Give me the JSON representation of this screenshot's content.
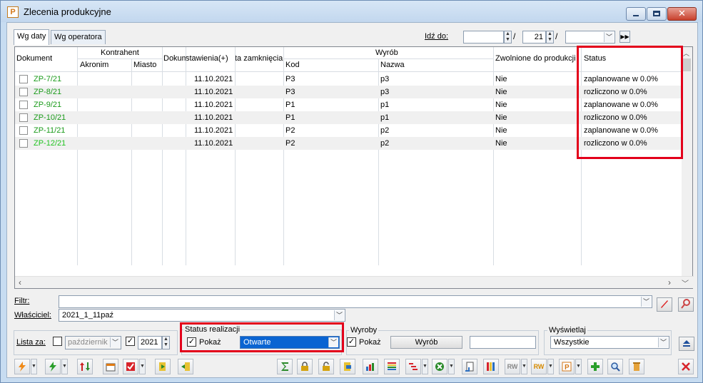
{
  "window": {
    "title": "Zlecenia produkcyjne",
    "app_icon_letter": "P"
  },
  "tabs": [
    "Wg daty",
    "Wg operatora"
  ],
  "goto": {
    "label": "Idź do:",
    "day": "",
    "month": "21",
    "year": ""
  },
  "grid": {
    "headers": {
      "dokument": "Dokument",
      "kontrahent": "Kontrahent",
      "akronim": "Akronim",
      "miasto": "Miasto",
      "dokumenty": "Dokum",
      "data_wystawienia": "stawienia(+)",
      "data_zamkniecia": "ta zamknięcia",
      "wyrob": "Wyrób",
      "kod": "Kod",
      "nazwa": "Nazwa",
      "zwolnione": "Zwolnione do produkcji",
      "status": "Status"
    },
    "rows": [
      {
        "doc": "ZP-7/21",
        "date": "11.10.2021",
        "kod": "P3",
        "nazwa": "p3",
        "zwolnione": "Nie",
        "status": "zaplanowane w 0.0%"
      },
      {
        "doc": "ZP-8/21",
        "date": "11.10.2021",
        "kod": "P3",
        "nazwa": "p3",
        "zwolnione": "Nie",
        "status": "rozliczono w 0.0%"
      },
      {
        "doc": "ZP-9/21",
        "date": "11.10.2021",
        "kod": "P1",
        "nazwa": "p1",
        "zwolnione": "Nie",
        "status": "zaplanowane w 0.0%"
      },
      {
        "doc": "ZP-10/21",
        "date": "11.10.2021",
        "kod": "P1",
        "nazwa": "p1",
        "zwolnione": "Nie",
        "status": "rozliczono w 0.0%"
      },
      {
        "doc": "ZP-11/21",
        "date": "11.10.2021",
        "kod": "P2",
        "nazwa": "p2",
        "zwolnione": "Nie",
        "status": "zaplanowane w 0.0%"
      },
      {
        "doc": "ZP-12/21",
        "date": "11.10.2021",
        "kod": "P2",
        "nazwa": "p2",
        "zwolnione": "Nie",
        "status": "rozliczono w 0.0%"
      }
    ]
  },
  "filters": {
    "filtr_label": "Filtr:",
    "filtr_value": "",
    "wlasciciel_label": "Właściciel:",
    "wlasciciel_value": "2021_1_11paź",
    "lista_za_label": "Lista za:",
    "month_value": "październik",
    "year_value": "2021"
  },
  "status_realizacji": {
    "title": "Status realizacji",
    "pokaz_label": "Pokaż",
    "value": "Otwarte"
  },
  "wyroby": {
    "title": "Wyroby",
    "pokaz_label": "Pokaż",
    "button_label": "Wyrób",
    "value": ""
  },
  "wyswietlaj": {
    "title": "Wyświetlaj",
    "value": "Wszystkie"
  },
  "colors": {
    "highlight_red": "#e3001b",
    "link_green": "#1b9b1b",
    "selection_blue": "#0a64d2"
  }
}
